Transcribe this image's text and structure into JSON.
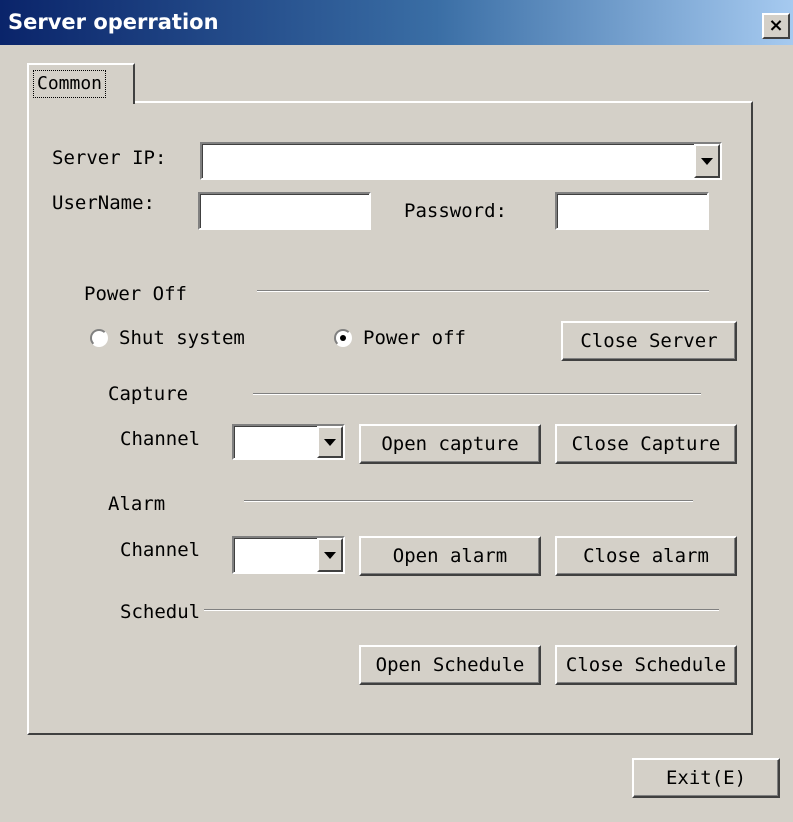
{
  "window": {
    "title": "Server operration",
    "close_glyph": "×"
  },
  "tabs": [
    {
      "label": "Common",
      "active": true
    }
  ],
  "server": {
    "ip_label": "Server IP:",
    "ip_value": "",
    "username_label": "UserName:",
    "username_value": "",
    "password_label": "Password:",
    "password_value": ""
  },
  "power_off": {
    "group_label": "Power Off",
    "option_shut": "Shut system",
    "option_power": "Power off",
    "selected": "Power off",
    "close_server_button": "Close Server"
  },
  "capture": {
    "group_label": "Capture",
    "channel_label": "Channel",
    "channel_value": "",
    "open_button": "Open capture",
    "close_button": "Close Capture"
  },
  "alarm": {
    "group_label": "Alarm",
    "channel_label": "Channel",
    "channel_value": "",
    "open_button": "Open alarm",
    "close_button": "Close alarm"
  },
  "schedule": {
    "group_label": "Schedul",
    "open_button": "Open Schedule",
    "close_button": "Close Schedule"
  },
  "footer": {
    "exit_button": "Exit(E)"
  },
  "icons": {
    "close": "close-icon",
    "dropdown": "chevron-down-icon",
    "radio": "radio-icon"
  },
  "colors": {
    "dialog_face": "#d4d0c8",
    "title_start": "#0a246a",
    "title_end": "#a6caf0"
  }
}
